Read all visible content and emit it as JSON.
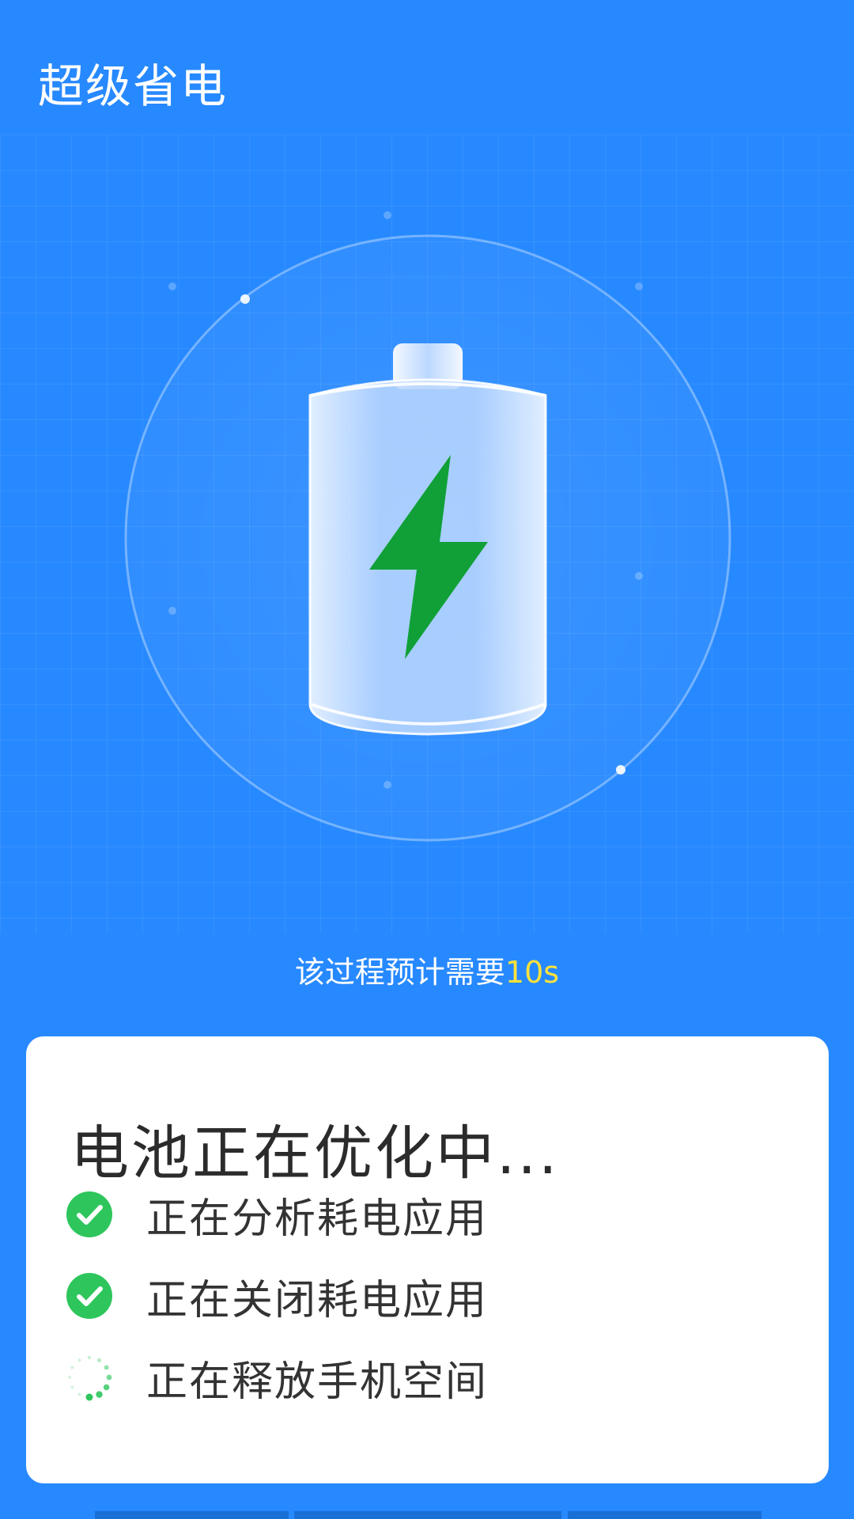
{
  "header": {
    "title": "超级省电"
  },
  "hero": {
    "icon": "battery-charging-icon",
    "estimate_prefix": "该过程预计需要",
    "estimate_time": "10s"
  },
  "card": {
    "title": "电池正在优化中...",
    "steps": [
      {
        "label": "正在分析耗电应用",
        "status": "done",
        "icon": "check-circle-icon"
      },
      {
        "label": "正在关闭耗电应用",
        "status": "done",
        "icon": "check-circle-icon"
      },
      {
        "label": "正在释放手机空间",
        "status": "loading",
        "icon": "spinner-icon"
      }
    ]
  },
  "colors": {
    "background": "#2789ff",
    "accent_time": "#ffe23a",
    "bolt": "#10a037",
    "check": "#2ec65c"
  }
}
